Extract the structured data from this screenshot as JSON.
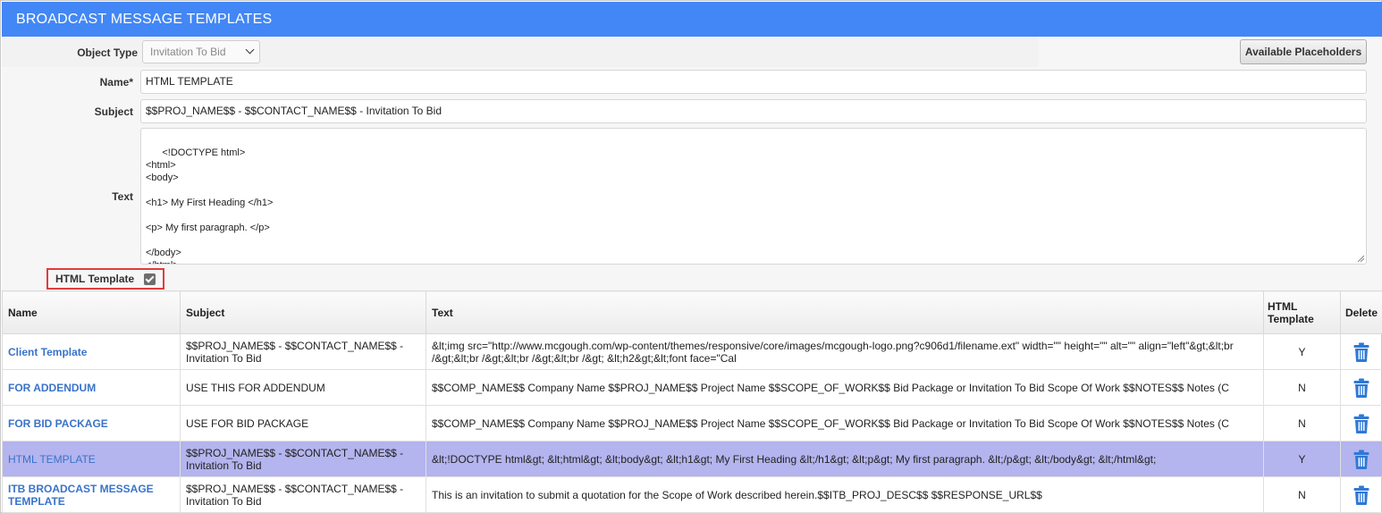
{
  "window": {
    "title": "BROADCAST MESSAGE TEMPLATES"
  },
  "form": {
    "object_type_label": "Object Type",
    "object_type_value": "Invitation To Bid",
    "available_placeholders_label": "Available Placeholders",
    "name_label": "Name*",
    "name_value": "HTML TEMPLATE",
    "subject_label": "Subject",
    "subject_value": "$$PROJ_NAME$$  - $$CONTACT_NAME$$ - Invitation To Bid",
    "text_label": "Text",
    "text_value": "<!DOCTYPE html>\n<html>\n<body>\n\n<h1> My First Heading </h1>\n\n<p> My first paragraph. </p>\n\n</body>\n</html>",
    "html_template_label": "HTML Template",
    "html_template_checked": true
  },
  "table": {
    "columns": [
      "Name",
      "Subject",
      "Text",
      "HTML Template",
      "Delete"
    ],
    "rows": [
      {
        "name": "Client Template",
        "subject": "$$PROJ_NAME$$ - $$CONTACT_NAME$$ - Invitation To Bid",
        "text": "&lt;img src=\"http://www.mcgough.com/wp-content/themes/responsive/core/images/mcgough-logo.png?c906d1/filename.ext\" width=\"\" height=\"\" alt=\"\" align=\"left\"&gt;&lt;br /&gt;&lt;br /&gt;&lt;br /&gt;&lt;br /&gt; &lt;h2&gt;&lt;font face=\"Cal",
        "html": "Y",
        "selected": false,
        "wrap": true
      },
      {
        "name": "FOR ADDENDUM",
        "subject": "USE THIS FOR ADDENDUM",
        "text": "$$COMP_NAME$$ Company Name $$PROJ_NAME$$ Project Name $$SCOPE_OF_WORK$$ Bid Package or Invitation To Bid Scope Of Work $$NOTES$$ Notes (C",
        "html": "N",
        "selected": false,
        "wrap": false
      },
      {
        "name": "FOR BID PACKAGE",
        "subject": "USE FOR BID PACKAGE",
        "text": "$$COMP_NAME$$ Company Name $$PROJ_NAME$$ Project Name $$SCOPE_OF_WORK$$ Bid Package or Invitation To Bid Scope Of Work $$NOTES$$ Notes (C",
        "html": "N",
        "selected": false,
        "wrap": false
      },
      {
        "name": "HTML TEMPLATE",
        "subject": "$$PROJ_NAME$$ - $$CONTACT_NAME$$ - Invitation To Bid",
        "text": "&lt;!DOCTYPE html&gt; &lt;html&gt; &lt;body&gt; &lt;h1&gt; My First Heading &lt;/h1&gt; &lt;p&gt; My first paragraph. &lt;/p&gt; &lt;/body&gt; &lt;/html&gt;",
        "html": "Y",
        "selected": true,
        "wrap": false
      },
      {
        "name": "ITB BROADCAST MESSAGE TEMPLATE",
        "subject": "$$PROJ_NAME$$ - $$CONTACT_NAME$$ - Invitation To Bid",
        "text": "This is an invitation to submit a quotation for the Scope of Work described herein.$$ITB_PROJ_DESC$$ $$RESPONSE_URL$$",
        "html": "N",
        "selected": false,
        "wrap": false
      }
    ]
  },
  "icons": {
    "dropdown": "chevron-down-icon",
    "delete": "trash-icon",
    "checkbox": "checkmark-icon"
  },
  "colors": {
    "header_bg": "#4287f5",
    "selected_row": "#b4b4ee",
    "link": "#3a73c9",
    "highlight_border": "#e03c3c",
    "trash": "#2f78d6"
  }
}
